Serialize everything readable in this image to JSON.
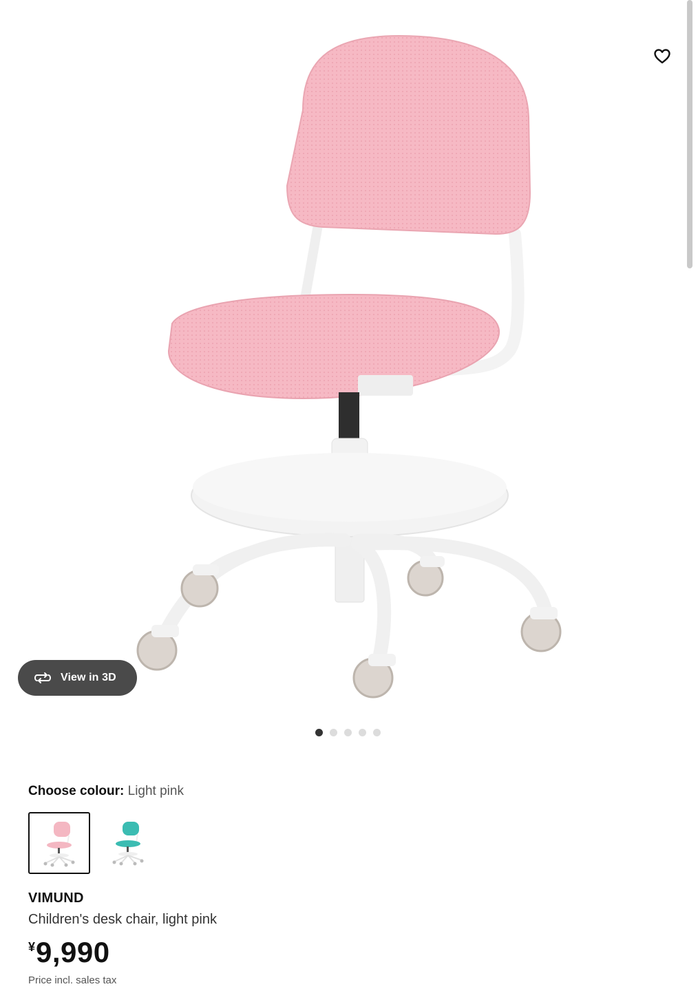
{
  "gallery": {
    "view3d_label": "View in 3D",
    "icons": {
      "favourite": "heart-icon",
      "rotate": "rotate-3d-icon"
    },
    "image_count": 5,
    "active_image": 1
  },
  "colour": {
    "heading_label": "Choose colour:",
    "selected_value": "Light pink",
    "swatches": [
      {
        "name": "Light pink",
        "color": "#f4b7c2",
        "selected": true
      },
      {
        "name": "Turquoise",
        "color": "#3bbcb2",
        "selected": false
      }
    ]
  },
  "product": {
    "name": "VIMUND",
    "description": "Children's desk chair, light pink",
    "currency": "¥",
    "price": "9,990",
    "price_note": "Price incl. sales tax"
  },
  "colors": {
    "accent_dark": "#4a4a4a",
    "text": "#111111",
    "chair_pink": "#f4b7c2"
  }
}
